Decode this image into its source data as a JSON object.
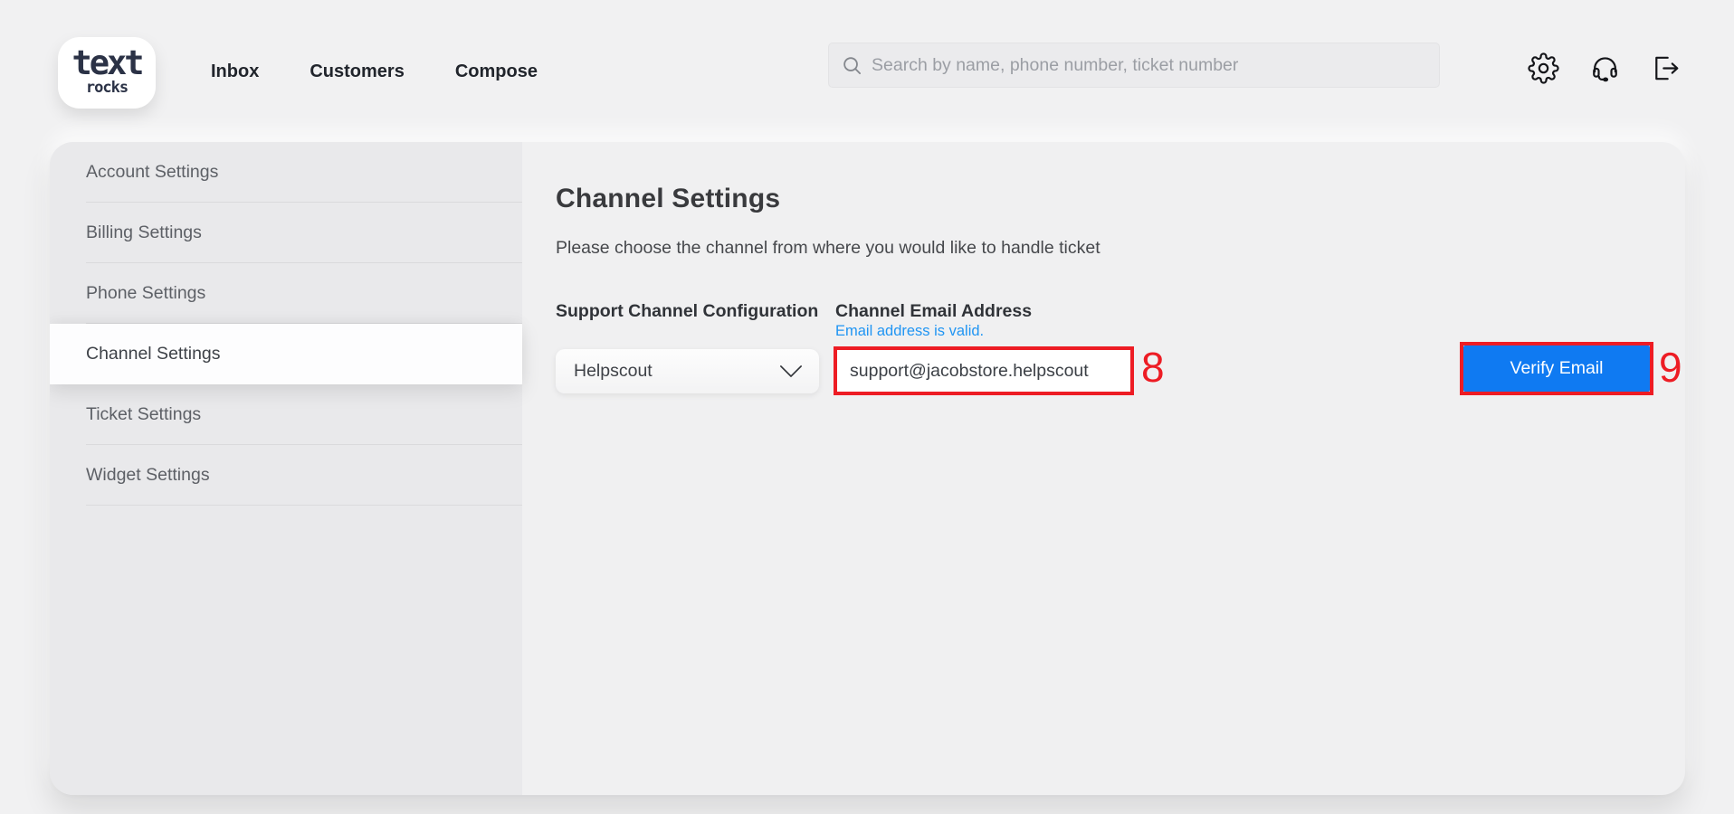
{
  "brand": {
    "name_line1": "text",
    "name_line2": "rocks"
  },
  "nav": {
    "items": [
      {
        "label": "Inbox"
      },
      {
        "label": "Customers"
      },
      {
        "label": "Compose"
      }
    ]
  },
  "search": {
    "placeholder": "Search by name, phone number, ticket number",
    "icon": "search-icon"
  },
  "topbar": {
    "icons": [
      {
        "name": "settings-gear-icon"
      },
      {
        "name": "support-headset-icon"
      },
      {
        "name": "logout-icon"
      }
    ]
  },
  "sidebar": {
    "items": [
      {
        "label": "Account Settings",
        "active": false
      },
      {
        "label": "Billing Settings",
        "active": false
      },
      {
        "label": "Phone Settings",
        "active": false
      },
      {
        "label": "Channel Settings",
        "active": true
      },
      {
        "label": "Ticket Settings",
        "active": false
      },
      {
        "label": "Widget Settings",
        "active": false
      }
    ]
  },
  "main": {
    "title": "Channel Settings",
    "subtitle": "Please choose the channel from where you would like to handle ticket",
    "support_channel": {
      "label": "Support Channel Configuration",
      "selected_option": "Helpscout",
      "dropdown_icon": "chevron-down-icon"
    },
    "channel_email": {
      "label": "Channel Email Address",
      "validation_message": "Email address is valid.",
      "value": "support@jacobstore.helpscout"
    },
    "verify_button": {
      "label": "Verify Email"
    },
    "annotations": [
      {
        "number": "8"
      },
      {
        "number": "9"
      }
    ]
  },
  "colors": {
    "annotation_red": "#ed1c24",
    "button_blue": "#0f7af2",
    "validation_blue": "#2095f3"
  }
}
